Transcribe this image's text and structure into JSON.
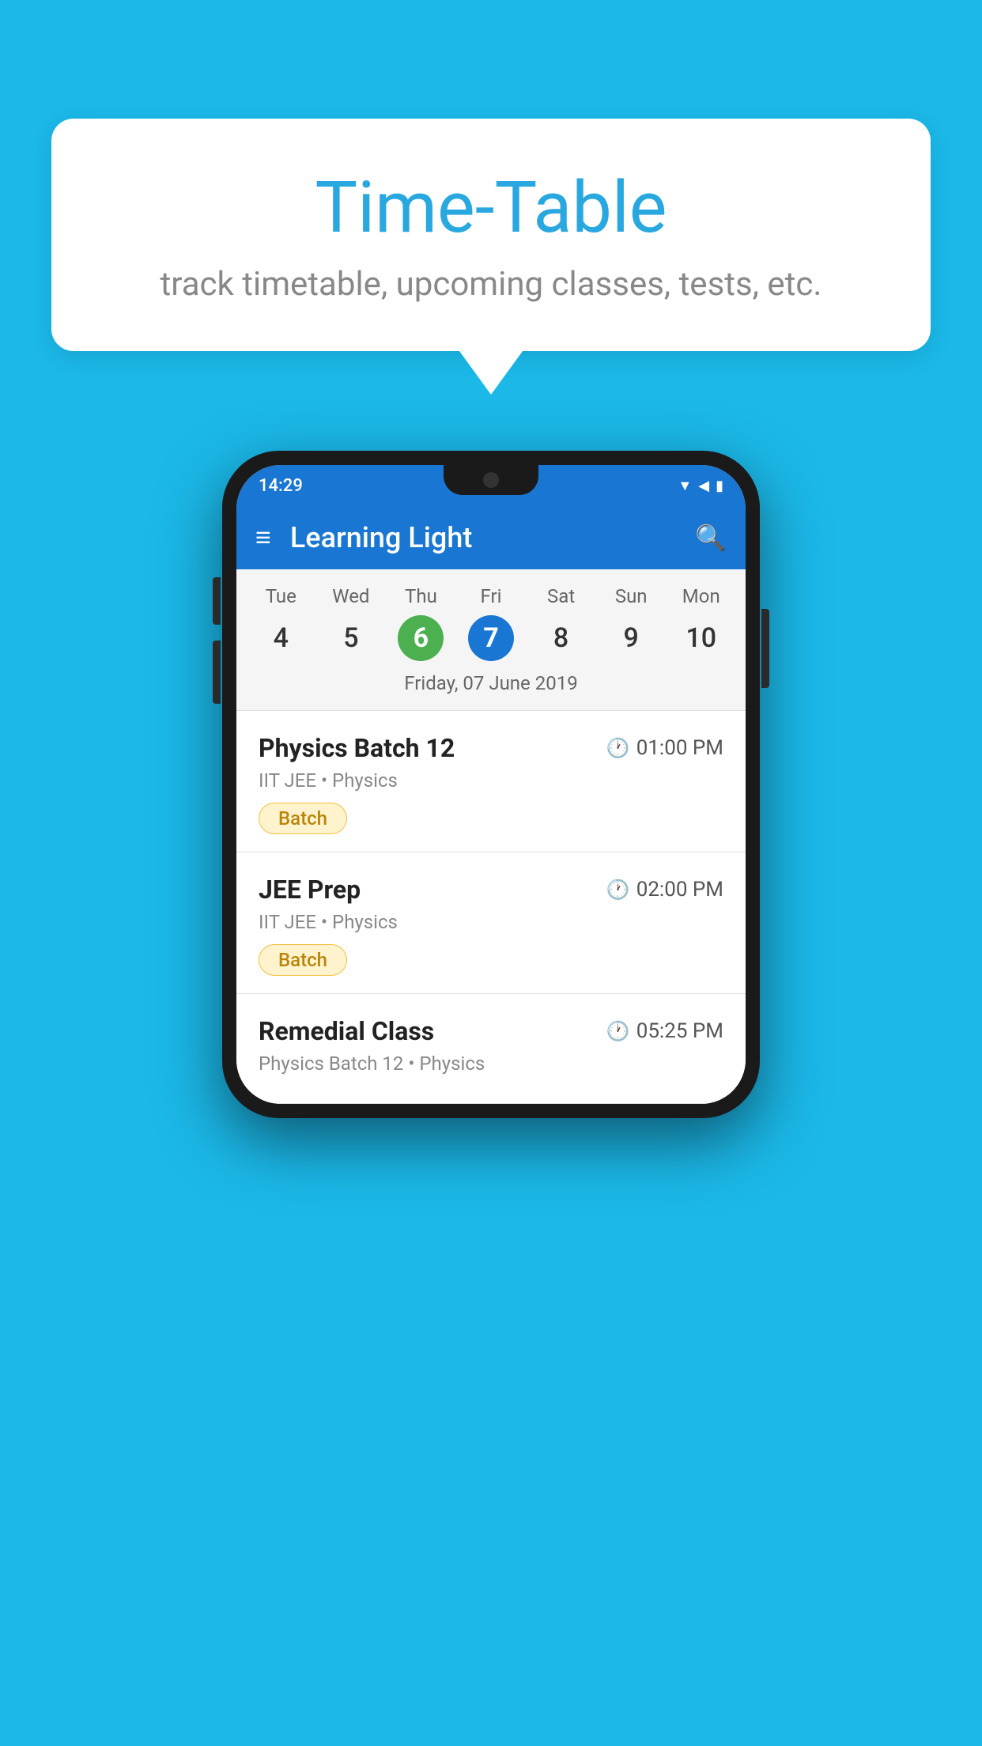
{
  "background_color": "#1BB8E8",
  "hero_card": {
    "title": "Time-Table",
    "subtitle": "track timetable, upcoming classes, tests, etc."
  },
  "phone": {
    "status_bar": {
      "time": "14:29",
      "icons": [
        "wifi",
        "signal",
        "battery"
      ]
    },
    "app_bar": {
      "title": "Learning Light",
      "menu_icon": "≡",
      "search_icon": "🔍"
    },
    "calendar": {
      "days": [
        {
          "name": "Tue",
          "num": "4",
          "state": "normal"
        },
        {
          "name": "Wed",
          "num": "5",
          "state": "normal"
        },
        {
          "name": "Thu",
          "num": "6",
          "state": "today"
        },
        {
          "name": "Fri",
          "num": "7",
          "state": "selected"
        },
        {
          "name": "Sat",
          "num": "8",
          "state": "normal"
        },
        {
          "name": "Sun",
          "num": "9",
          "state": "normal"
        },
        {
          "name": "Mon",
          "num": "10",
          "state": "normal"
        }
      ],
      "selected_date_label": "Friday, 07 June 2019"
    },
    "classes": [
      {
        "title": "Physics Batch 12",
        "time": "01:00 PM",
        "subtitle": "IIT JEE • Physics",
        "badge": "Batch"
      },
      {
        "title": "JEE Prep",
        "time": "02:00 PM",
        "subtitle": "IIT JEE • Physics",
        "badge": "Batch"
      },
      {
        "title": "Remedial Class",
        "time": "05:25 PM",
        "subtitle": "Physics Batch 12 • Physics",
        "badge": null
      }
    ]
  }
}
